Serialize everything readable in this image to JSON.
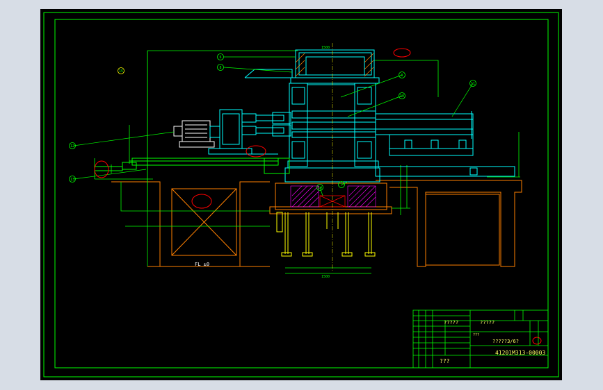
{
  "drawing": {
    "drawing_number": "41201M313-00003",
    "title_text_1": "?????",
    "title_text_2": "?????",
    "scale_text": "?????3/6?",
    "small_text": "???",
    "bottom_text": "???",
    "floor_label": "FL ±0",
    "dim_0": "1500",
    "dim_1": "1500"
  },
  "balloons": [
    "6",
    "8",
    "9",
    "10",
    "11",
    "12",
    "13",
    "14",
    "7",
    "15"
  ],
  "colors": {
    "background": "#000000",
    "frame": "#00ff00",
    "machine": "#00ffff",
    "foundation": "#ff8000",
    "annotation": "#ffff00",
    "revision_cloud": "#ff0000",
    "hatch": "#ff00ff",
    "screen": "#d7dde6"
  }
}
